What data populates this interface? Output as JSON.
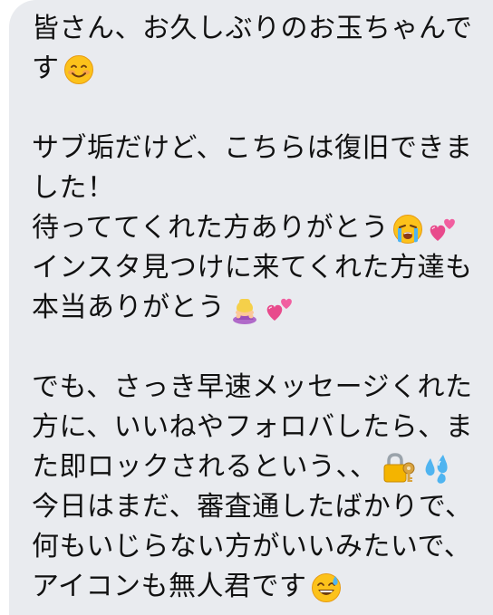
{
  "message": {
    "lines": [
      "皆さん、お久しぶりのお玉ちゃんで",
      "す",
      "",
      "サブ垢だけど、こちらは復旧できま",
      "した！",
      "待っててくれた方ありがとう",
      "インスタ見つけに来てくれた方達も",
      "本当ありがとう",
      "",
      "でも、さっき早速メッセージくれた",
      "方に、いいねやフォロバしたら、ま",
      "た即ロックされるという、、",
      "今日はまだ、審査通したばかりで、",
      "何もいじらない方がいいみたいで、",
      "アイコンも無人君です"
    ],
    "emojis": {
      "line_2": [
        "smiling-face-icon"
      ],
      "line_6": [
        "crying-face-icon",
        "two-hearts-icon"
      ],
      "line_8": [
        "bowing-person-icon",
        "two-hearts-icon"
      ],
      "line_12": [
        "locked-with-key-icon",
        "sweat-droplets-icon"
      ],
      "line_15": [
        "grinning-sweat-face-icon"
      ]
    }
  },
  "colors": {
    "bubble_background": "#e9ebef",
    "text": "#111111"
  }
}
